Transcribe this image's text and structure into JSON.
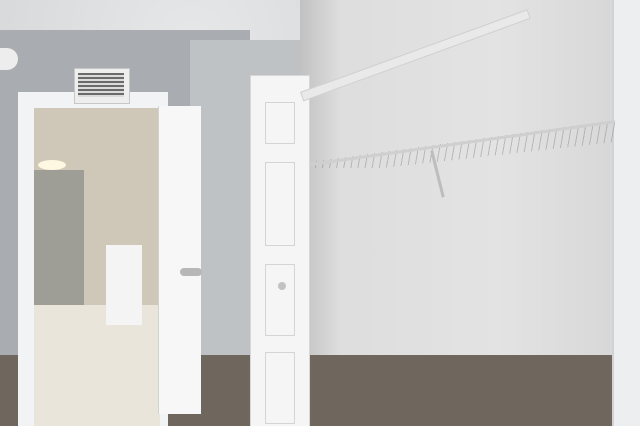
{
  "scene": {
    "description_items": [
      "textured-ceiling",
      "hvac-vent",
      "hallway-doorway",
      "open-white-door",
      "closet-door",
      "wire-shelf",
      "closet-rod",
      "carpet",
      "tile-floor"
    ],
    "colors": {
      "wall": "#a9adb1",
      "closet_wall": "#e0e0e0",
      "carpet": "#6f665d",
      "door": "#f5f5f5",
      "tile": "#e9e5da"
    }
  }
}
